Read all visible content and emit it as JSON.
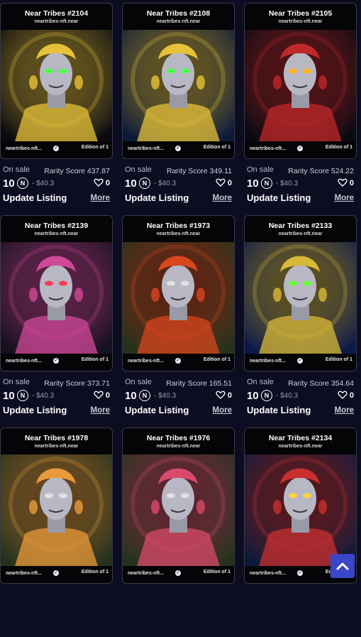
{
  "cards": [
    {
      "title": "Near Tribes #2104",
      "sub": "neartribes-nft.near",
      "creator": "neartribes-nft...",
      "edition": "Edition of 1",
      "status": "On sale",
      "rarity": "Rarity Score 437.87",
      "price": "10",
      "usd": "- $40.3",
      "likes": "0",
      "action": "Update Listing",
      "more": "More",
      "bg": "#0a0a10",
      "accent": "#e6c23a",
      "eyes": "#4dff4d"
    },
    {
      "title": "Near Tribes #2108",
      "sub": "neartribes-nft.near",
      "creator": "neartribes-nft...",
      "edition": "Edition of 1",
      "status": "On sale",
      "rarity": "Rarity Score 349.11",
      "price": "10",
      "usd": "- $40.3",
      "likes": "0",
      "action": "Update Listing",
      "more": "More",
      "bg": "#0c1a3a",
      "accent": "#e6c23a",
      "eyes": "#4dff4d"
    },
    {
      "title": "Near Tribes #2105",
      "sub": "neartribes-nft.near",
      "creator": "neartribes-nft...",
      "edition": "Edition of 1",
      "status": "On sale",
      "rarity": "Rarity Score 524.22",
      "price": "10",
      "usd": "- $40.3",
      "likes": "0",
      "action": "Update Listing",
      "more": "More",
      "bg": "#0a0a12",
      "accent": "#c0282a",
      "eyes": "#ffb020"
    },
    {
      "title": "Near Tribes #2139",
      "sub": "neartribes-nft.near",
      "creator": "neartribes-nft...",
      "edition": "Edition of 1",
      "status": "On sale",
      "rarity": "Rarity Score 373.71",
      "price": "10",
      "usd": "- $40.3",
      "likes": "0",
      "action": "Update Listing",
      "more": "More",
      "bg": "#14101e",
      "accent": "#d04898",
      "eyes": "#ff3a5a"
    },
    {
      "title": "Near Tribes #1973",
      "sub": "neartribes-nft.near",
      "creator": "neartribes-nft...",
      "edition": "Edition of 1",
      "status": "On sale",
      "rarity": "Rarity Score 165.51",
      "price": "10",
      "usd": "- $40.3",
      "likes": "0",
      "action": "Update Listing",
      "more": "More",
      "bg": "#24321c",
      "accent": "#d8461e",
      "eyes": "#e0e0e0"
    },
    {
      "title": "Near Tribes #2133",
      "sub": "neartribes-nft.near",
      "creator": "neartribes-nft...",
      "edition": "Edition of 1",
      "status": "On sale",
      "rarity": "Rarity Score 354.64",
      "price": "10",
      "usd": "- $40.3",
      "likes": "0",
      "action": "Update Listing",
      "more": "More",
      "bg": "#0c1a4a",
      "accent": "#d8b838",
      "eyes": "#6aff3a"
    },
    {
      "title": "Near Tribes #1978",
      "sub": "neartribes-nft.near",
      "creator": "neartribes-nft...",
      "edition": "Edition of 1",
      "status": "",
      "rarity": "",
      "price": "",
      "usd": "",
      "likes": "",
      "action": "",
      "more": "",
      "bg": "#24321c",
      "accent": "#e89a3a",
      "eyes": "#e0e0e0"
    },
    {
      "title": "Near Tribes #1976",
      "sub": "neartribes-nft.near",
      "creator": "neartribes-nft...",
      "edition": "Edition of 1",
      "status": "",
      "rarity": "",
      "price": "",
      "usd": "",
      "likes": "",
      "action": "",
      "more": "",
      "bg": "#24321c",
      "accent": "#d84a6a",
      "eyes": "#e0e0e0"
    },
    {
      "title": "Near Tribes #2134",
      "sub": "neartribes-nft.near",
      "creator": "neartribes-nft...",
      "edition": "Edition of 1",
      "status": "",
      "rarity": "",
      "price": "",
      "usd": "",
      "likes": "",
      "action": "",
      "more": "",
      "bg": "#0c1a3a",
      "accent": "#c83030",
      "eyes": "#ffd040"
    }
  ],
  "near_symbol": "N",
  "verified_symbol": "✓"
}
